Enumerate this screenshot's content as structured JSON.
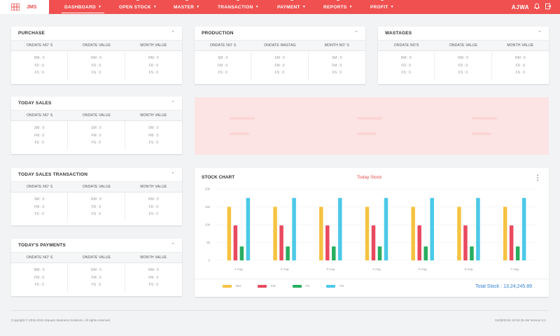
{
  "nav": {
    "logo": "JMS",
    "items": [
      {
        "label": "DASHBOARD"
      },
      {
        "label": "OPEN STOCK"
      },
      {
        "label": "MASTER"
      },
      {
        "label": "TRANSACTION"
      },
      {
        "label": "PAYMENT"
      },
      {
        "label": "REPORTS"
      },
      {
        "label": "PROFIT"
      }
    ],
    "user": "AJWA",
    "accent": "#f05050"
  },
  "cards": {
    "purchase": {
      "title": "PURCHASE",
      "headers": [
        "ONDATE NO' S",
        "ONDATE VALUE",
        "MONTH VALUE"
      ],
      "cols": [
        [
          "RM : 0",
          "FD : 0",
          "FS : 0"
        ],
        [
          "RM : 0",
          "FD : 0",
          "FS : 0"
        ],
        [
          "RM : 0",
          "FD : 0",
          "FS : 0"
        ]
      ]
    },
    "production": {
      "title": "PRODUCTION",
      "headers": [
        "ONDATE NO' S",
        "ONDATE WASTAG",
        "MONTH NO' S"
      ],
      "cols": [
        [
          "SM : 0",
          "FM : 0",
          "FS : 0"
        ],
        [
          "SM : 0",
          "FM : 0",
          "FS : 0"
        ],
        [
          "SM : 0",
          "FM : 0",
          "FS : 0"
        ]
      ]
    },
    "wastages": {
      "title": "WASTAGES",
      "headers": [
        "ONDATE NO'S",
        "ONDATE VALUE",
        "MONTH VALUE"
      ],
      "cols": [
        [
          "RM : 0",
          "FD : 0",
          "FS : 0"
        ],
        [
          "RM : 0",
          "FD : 0",
          "FS : 0"
        ],
        [
          "RM : 0",
          "FD : 0",
          "FS : 0"
        ]
      ]
    },
    "today_sales": {
      "title": "TODAY SALES",
      "headers": [
        "ONDATE NO' S",
        "ONDATE VALUE",
        "MONTH VALUE"
      ],
      "cols": [
        [
          "SM : 0",
          "FM : 0",
          "FS : 0"
        ],
        [
          "SM : 0",
          "FM : 0",
          "FS : 0"
        ],
        [
          "SM : 0",
          "FM : 0",
          "FS : 0"
        ]
      ]
    },
    "today_sales_transaction": {
      "title": "TODAY SALES TRANSACTION",
      "headers": [
        "ONDATE NO' S",
        "ONDATE VALUE",
        "MONTH VALUE"
      ],
      "cols": [
        [
          "SM : 0",
          "FM : 0",
          "FS : 0"
        ],
        [
          "RM : 0",
          "FD : 0",
          "FS : 0"
        ],
        [
          "RM : 0",
          "FD : 0",
          "FS : 0"
        ]
      ]
    },
    "today_payments": {
      "title": "TODAY'S PAYMENTS",
      "headers": [
        "ONDATE NO' S",
        "ONDATE VALUE",
        "MONTH VALUE"
      ],
      "cols": [
        [
          "RM : 0",
          "FM : 0",
          "FS : 0"
        ],
        [
          "RM : 0",
          "FM : 0",
          "FS : 0"
        ],
        [
          "RM : 0",
          "FM : 0",
          "FS : 0"
        ]
      ]
    }
  },
  "chart": {
    "title": "STOCK CHART",
    "subtitle": "Today Stock",
    "total": "Total Stock : 13,24,245.89",
    "colors": [
      "#f5c342",
      "#e84a5f",
      "#27ae60",
      "#4cc9e8"
    ]
  },
  "chart_data": {
    "type": "bar",
    "categories": [
      "1 Aug",
      "2 Aug",
      "3 Aug",
      "4 Aug",
      "5 Aug",
      "6 Aug",
      "7 Aug"
    ],
    "ylim": [
      0,
      20000
    ],
    "yticks": [
      "0",
      "5k",
      "10k",
      "15k",
      "20k"
    ],
    "series": [
      {
        "name": "RM",
        "values": [
          15000,
          15000,
          15000,
          15000,
          15000,
          15000,
          15000
        ]
      },
      {
        "name": "FM",
        "values": [
          9800,
          9800,
          9800,
          9800,
          9800,
          9800,
          9800
        ]
      },
      {
        "name": "FS",
        "values": [
          3900,
          3900,
          3900,
          3900,
          3900,
          3900,
          3900
        ]
      },
      {
        "name": "FD",
        "values": [
          17500,
          17500,
          17500,
          17500,
          17500,
          17500,
          17500
        ]
      }
    ]
  },
  "footer": {
    "copyright": "Copyright © 2015-2016 iSquare Business Solutions. All rights reserved.",
    "version": "01/08/2016 12:06:35 AM Version 0.1"
  }
}
